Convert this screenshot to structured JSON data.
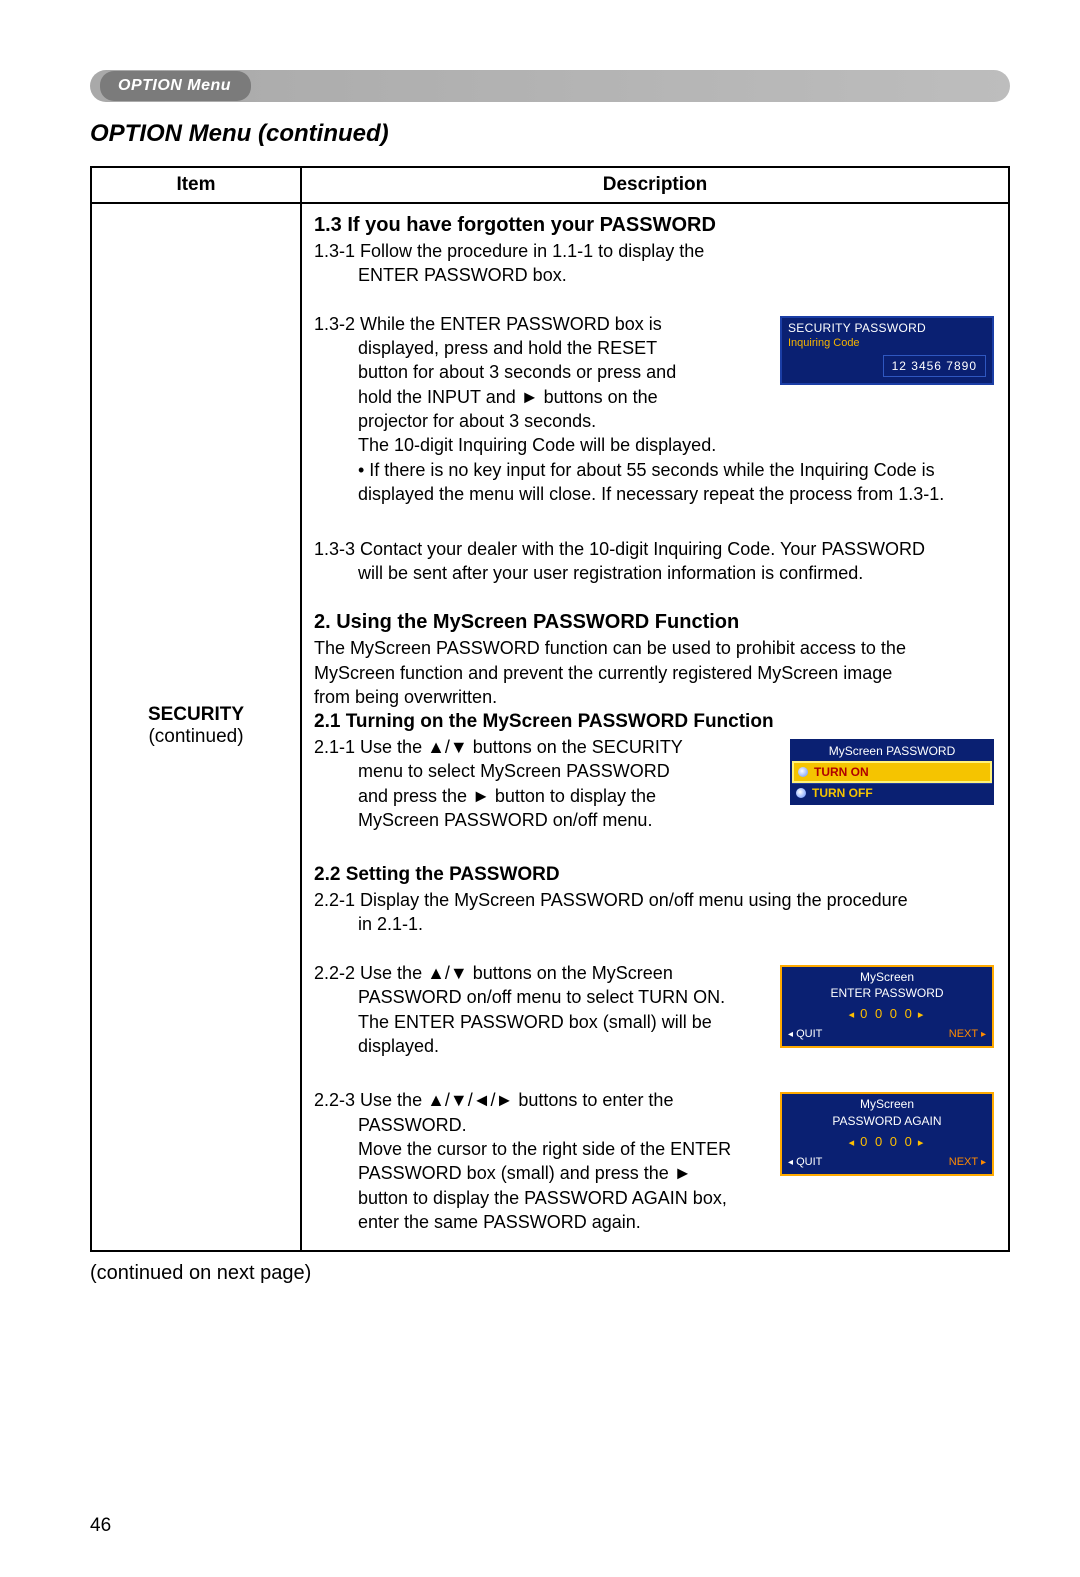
{
  "header_tab": "OPTION Menu",
  "section_title": "OPTION Menu (continued)",
  "table": {
    "headers": {
      "item": "Item",
      "description": "Description"
    },
    "item_label": "SECURITY",
    "item_sub": "(continued)"
  },
  "s13": {
    "heading": "1.3 If you have forgotten your PASSWORD",
    "p1_num": "1.3-1",
    "p1_a": "Follow the procedure in 1.1-1 to display the",
    "p1_b": "ENTER PASSWORD box.",
    "p2_num": "1.3-2",
    "p2_a": "While the ENTER PASSWORD box is",
    "p2_b": "displayed, press and hold the RESET",
    "p2_c": "button for about 3 seconds or press and",
    "p2_d": "hold the INPUT and ► buttons on the",
    "p2_e": "projector for about 3 seconds.",
    "p2_f": "The 10-digit Inquiring Code will be displayed.",
    "p2_g": "• If there is no key input for about 55 seconds while the Inquiring Code is",
    "p2_h": "displayed the menu will close. If necessary repeat the process from 1.3-1.",
    "p3_num": "1.3-3",
    "p3_a": "Contact your dealer with the 10-digit Inquiring Code. Your PASSWORD",
    "p3_b": "will be sent after your user registration information is confirmed."
  },
  "inq": {
    "title": "SECURITY PASSWORD",
    "sub": "Inquiring Code",
    "code": "12 3456 7890"
  },
  "s2": {
    "heading": "2. Using the MyScreen PASSWORD Function",
    "intro_a": "The MyScreen PASSWORD function can be used to prohibit access to the",
    "intro_b": "MyScreen function and prevent the currently registered MyScreen image",
    "intro_c": "from being overwritten."
  },
  "s21": {
    "heading": "2.1 Turning on the MyScreen PASSWORD Function",
    "p1_num": "2.1-1",
    "p1_a": "Use the ▲/▼ buttons on the SECURITY",
    "p1_b": "menu to select MyScreen PASSWORD",
    "p1_c": "and press the ► button to display the",
    "p1_d": "MyScreen PASSWORD on/off menu."
  },
  "msmenu": {
    "title": "MyScreen PASSWORD",
    "on": "TURN ON",
    "off": "TURN OFF"
  },
  "s22": {
    "heading": "2.2 Setting the PASSWORD",
    "p1_num": "2.2-1",
    "p1_a": "Display the MyScreen PASSWORD on/off menu using the procedure",
    "p1_b": "in 2.1-1.",
    "p2_num": "2.2-2",
    "p2_a": "Use the ▲/▼ buttons on the MyScreen",
    "p2_b": "PASSWORD on/off menu to select TURN ON.",
    "p2_c": "The ENTER PASSWORD box (small) will be",
    "p2_d": "displayed.",
    "p3_num": "2.2-3",
    "p3_a": "Use the ▲/▼/◄/► buttons to enter the",
    "p3_b": "PASSWORD.",
    "p3_c": "Move the cursor to the right side of the ENTER",
    "p3_d": "PASSWORD box (small) and press the ►",
    "p3_e": "button to display the PASSWORD AGAIN box,",
    "p3_f": "enter the same PASSWORD again."
  },
  "pw1": {
    "t1": "MyScreen",
    "t2": "ENTER PASSWORD",
    "digits": "0 0 0 0",
    "quit": "QUIT",
    "next": "NEXT"
  },
  "pw2": {
    "t1": "MyScreen",
    "t2": "PASSWORD AGAIN",
    "digits": "0 0 0 0",
    "quit": "QUIT",
    "next": "NEXT"
  },
  "cont_next": "(continued on next page)",
  "page_number": "46"
}
